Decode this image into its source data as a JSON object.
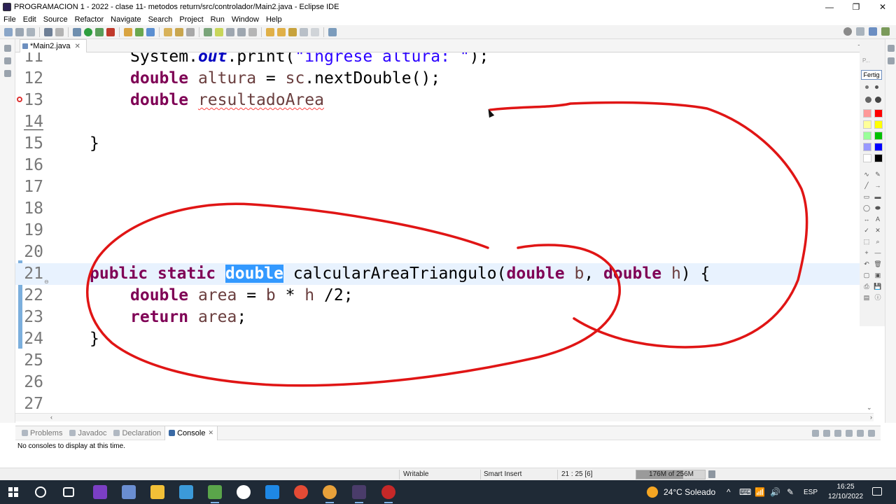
{
  "window": {
    "title": "PROGRAMACION 1 - 2022 - clase 11- metodos return/src/controlador/Main2.java - Eclipse IDE",
    "minimize": "—",
    "maximize": "❐",
    "close": "✕"
  },
  "menu": [
    "File",
    "Edit",
    "Source",
    "Refactor",
    "Navigate",
    "Search",
    "Project",
    "Run",
    "Window",
    "Help"
  ],
  "editor": {
    "tab_label": "*Main2.java",
    "tab_close": "✕",
    "lines": [
      {
        "n": "11",
        "tokens": [
          [
            "plain",
            "System."
          ],
          [
            "fld",
            "out"
          ],
          [
            "plain",
            ".print("
          ],
          [
            "str",
            "\"ingrese altura: \""
          ],
          [
            "plain",
            ");"
          ]
        ]
      },
      {
        "n": "12",
        "tokens": [
          [
            "kw",
            "double"
          ],
          [
            "plain",
            " "
          ],
          [
            "var",
            "altura"
          ],
          [
            "plain",
            " = "
          ],
          [
            "var",
            "sc"
          ],
          [
            "plain",
            ".nextDouble();"
          ]
        ]
      },
      {
        "n": "13",
        "tokens": [
          [
            "kw",
            "double"
          ],
          [
            "plain",
            " "
          ],
          [
            "err",
            "resultadoArea"
          ]
        ]
      },
      {
        "n": "14",
        "tokens": []
      },
      {
        "n": "15",
        "tokens": [
          [
            "plain",
            "}"
          ]
        ]
      },
      {
        "n": "16",
        "tokens": []
      },
      {
        "n": "17",
        "tokens": []
      },
      {
        "n": "18",
        "tokens": []
      },
      {
        "n": "19",
        "tokens": []
      },
      {
        "n": "20",
        "tokens": []
      },
      {
        "n": "21",
        "tokens": [
          [
            "kw",
            "public"
          ],
          [
            "plain",
            " "
          ],
          [
            "kw",
            "static"
          ],
          [
            "plain",
            " "
          ],
          [
            "sel",
            "double"
          ],
          [
            "plain",
            " calcularAreaTriangulo("
          ],
          [
            "kw",
            "double"
          ],
          [
            "plain",
            " "
          ],
          [
            "var",
            "b"
          ],
          [
            "plain",
            ", "
          ],
          [
            "kw",
            "double"
          ],
          [
            "plain",
            " "
          ],
          [
            "var",
            "h"
          ],
          [
            "plain",
            ") {"
          ]
        ]
      },
      {
        "n": "22",
        "tokens": [
          [
            "kw",
            "double"
          ],
          [
            "plain",
            " "
          ],
          [
            "var",
            "area"
          ],
          [
            "plain",
            " = "
          ],
          [
            "var",
            "b"
          ],
          [
            "plain",
            " * "
          ],
          [
            "var",
            "h"
          ],
          [
            "plain",
            " /2;"
          ]
        ]
      },
      {
        "n": "23",
        "tokens": [
          [
            "kw",
            "return"
          ],
          [
            "plain",
            " "
          ],
          [
            "var",
            "area"
          ],
          [
            "plain",
            ";"
          ]
        ]
      },
      {
        "n": "24",
        "tokens": [
          [
            "plain",
            "}"
          ]
        ]
      },
      {
        "n": "25",
        "tokens": []
      },
      {
        "n": "26",
        "tokens": []
      },
      {
        "n": "27",
        "tokens": []
      }
    ],
    "indent": {
      "11": 1,
      "12": 1,
      "13": 1,
      "15": 0,
      "21": 0,
      "22": 1,
      "23": 1,
      "24": 0
    },
    "current_line": "21",
    "error_line": "13",
    "fold_line": "21"
  },
  "annotation_palette": {
    "label": "P...",
    "button": "Fertig",
    "colors": [
      "#ff9999",
      "#ff0000",
      "#ffff99",
      "#ffff00",
      "#99ff99",
      "#00c000",
      "#9999ff",
      "#0000ff",
      "#ffffff",
      "#000000"
    ],
    "tools": [
      "∿",
      "✎",
      "╱",
      "→",
      "▭",
      "▬",
      "◯",
      "⬬",
      "↔",
      "A",
      "✓",
      "✕",
      "⬚",
      "⌕",
      "+",
      "—",
      "↶",
      "🗑",
      "▢",
      "▣",
      "⎙",
      "💾",
      "▤",
      "ⓘ"
    ]
  },
  "bottom_panel": {
    "tabs": [
      {
        "label": "Problems",
        "active": false
      },
      {
        "label": "Javadoc",
        "active": false
      },
      {
        "label": "Declaration",
        "active": false
      },
      {
        "label": "Console",
        "active": true
      }
    ],
    "console_message": "No consoles to display at this time."
  },
  "status": {
    "writable": "Writable",
    "insert_mode": "Smart Insert",
    "position": "21 : 25 [6]",
    "heap": "176M of 256M",
    "heap_fraction": 0.6875
  },
  "taskbar": {
    "weather": "24°C  Soleado",
    "time": "16:25",
    "date": "12/10/2022",
    "tray_icons": [
      "^",
      "⌨",
      "📶",
      "🔊",
      "✎",
      "ESP"
    ]
  },
  "colors": {
    "ink": "#e01515",
    "keyword": "#7f0055",
    "selection": "#3399ff",
    "current_line": "#e8f2fe"
  }
}
